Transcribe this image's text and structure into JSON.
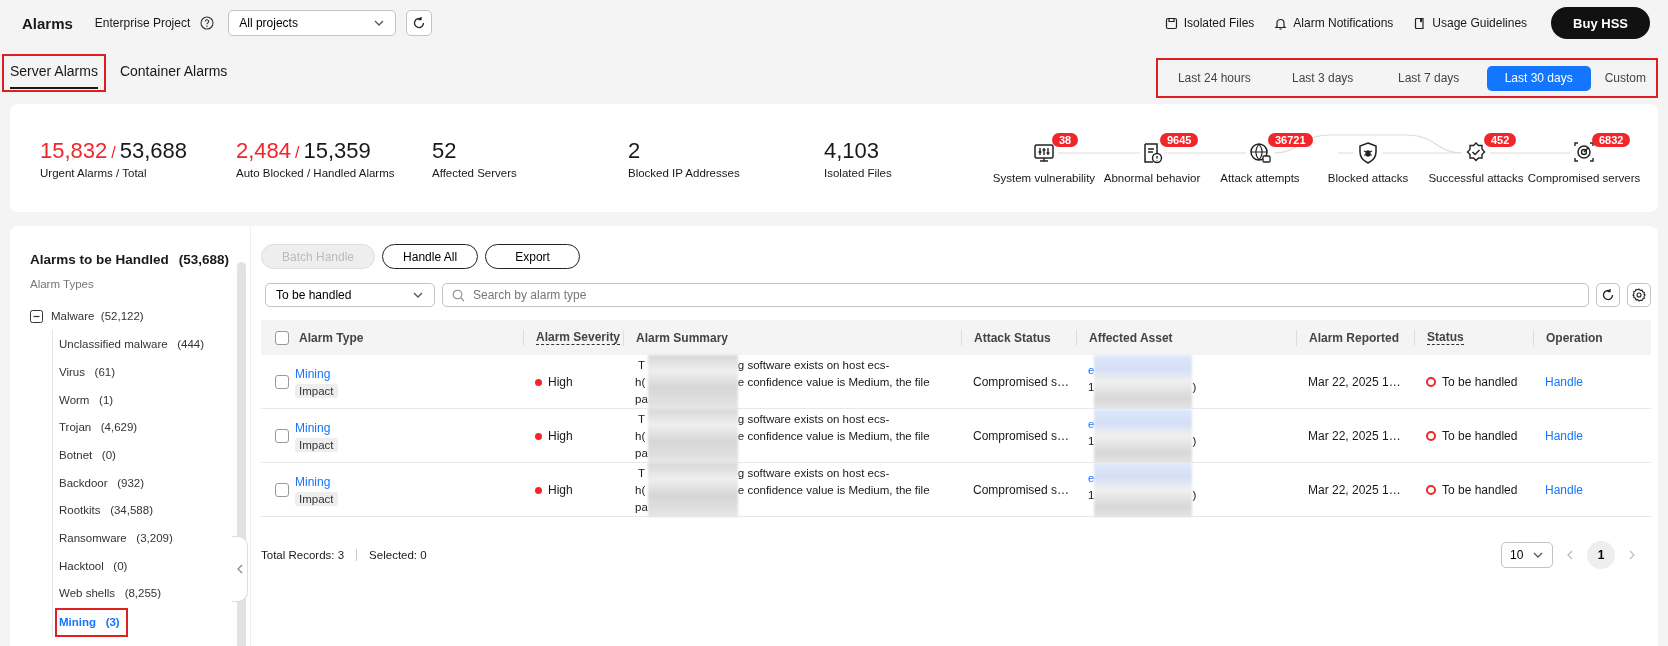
{
  "header": {
    "title": "Alarms",
    "project_label": "Enterprise Project",
    "project_select": "All projects",
    "links": [
      "Isolated Files",
      "Alarm Notifications",
      "Usage Guidelines"
    ],
    "buy_button": "Buy HSS"
  },
  "tabs": [
    {
      "label": "Server Alarms",
      "selected": true,
      "highlighted": true
    },
    {
      "label": "Container Alarms",
      "selected": false,
      "highlighted": false
    }
  ],
  "time_range": {
    "highlighted": true,
    "options": [
      {
        "label": "Last 24 hours",
        "selected": false
      },
      {
        "label": "Last 3 days",
        "selected": false
      },
      {
        "label": "Last 7 days",
        "selected": false
      },
      {
        "label": "Last 30 days",
        "selected": true
      },
      {
        "label": "Custom",
        "selected": false
      }
    ]
  },
  "stats": [
    {
      "kind": "ratio",
      "value": "15,832",
      "separator": "/",
      "total": "53,688",
      "label": "Urgent Alarms  / Total"
    },
    {
      "kind": "ratio",
      "value": "2,484",
      "separator": "/",
      "total": "15,359",
      "label": "Auto Blocked  / Handled Alarms"
    },
    {
      "kind": "single",
      "value": "52",
      "label": "Affected Servers"
    },
    {
      "kind": "single",
      "value": "2",
      "label": "Blocked IP Addresses"
    },
    {
      "kind": "single",
      "value": "4,103",
      "label": "Isolated Files"
    }
  ],
  "attack_chain": [
    {
      "label": "System vulnerability",
      "badge": "38"
    },
    {
      "label": "Abnormal behavior",
      "badge": "9645"
    },
    {
      "label": "Attack attempts",
      "badge": "36721"
    },
    {
      "label": "Blocked attacks"
    },
    {
      "label": "Successful attacks",
      "badge": "452"
    },
    {
      "label": "Compromised servers",
      "badge": "6832"
    }
  ],
  "sidebar": {
    "title": "Alarms to be Handled",
    "count": "(53,688)",
    "subtitle": "Alarm Types",
    "tree": [
      {
        "label": "Malware",
        "count": "(52,122)",
        "expanded": true,
        "selected": false,
        "children": [
          {
            "label": "Unclassified malware",
            "count": "(444)",
            "selected": false,
            "highlighted": false
          },
          {
            "label": "Virus",
            "count": "(61)",
            "selected": false,
            "highlighted": false
          },
          {
            "label": "Worm",
            "count": "(1)",
            "selected": false,
            "highlighted": false
          },
          {
            "label": "Trojan",
            "count": "(4,629)",
            "selected": false,
            "highlighted": false
          },
          {
            "label": "Botnet",
            "count": "(0)",
            "selected": false,
            "highlighted": false
          },
          {
            "label": "Backdoor",
            "count": "(932)",
            "selected": false,
            "highlighted": false
          },
          {
            "label": "Rootkits",
            "count": "(34,588)",
            "selected": false,
            "highlighted": false
          },
          {
            "label": "Ransomware",
            "count": "(3,209)",
            "selected": false,
            "highlighted": false
          },
          {
            "label": "Hacktool",
            "count": "(0)",
            "selected": false,
            "highlighted": false
          },
          {
            "label": "Web shells",
            "count": "(8,255)",
            "selected": false,
            "highlighted": false
          },
          {
            "label": "Mining",
            "count": "(3)",
            "selected": true,
            "highlighted": true
          }
        ]
      }
    ]
  },
  "toolbar": {
    "buttons": [
      {
        "label": "Batch Handle",
        "disabled": true
      },
      {
        "label": "Handle All",
        "disabled": false
      },
      {
        "label": "Export",
        "disabled": false
      }
    ],
    "status_filter": "To be handled",
    "search": {
      "placeholder": "Search by alarm type"
    }
  },
  "table": {
    "select_all_checked": false,
    "columns": [
      {
        "label": "Alarm Type",
        "dashed": false
      },
      {
        "label": "Alarm Severity",
        "dashed": true
      },
      {
        "label": "Alarm Summary",
        "dashed": false
      },
      {
        "label": "Attack Status",
        "dashed": false
      },
      {
        "label": "Affected Asset",
        "dashed": false
      },
      {
        "label": "Alarm Reported",
        "dashed": false
      },
      {
        "label": "Status",
        "dashed": true
      },
      {
        "label": "Operation",
        "dashed": false
      }
    ],
    "rows": [
      {
        "checked": false,
        "type": "Mining",
        "tag": "Impact",
        "severity": "High",
        "summary": [
          {
            "before": " T",
            "after": "g software exists on host ecs-"
          },
          {
            "before": "h(",
            "after": "e confidence value is Medium, the file"
          },
          {
            "before": "pa"
          }
        ],
        "attack_status": "Compromised s…",
        "asset": [
          {
            "before": "e"
          },
          {
            "before": "1",
            "after": ")"
          }
        ],
        "reported": "Mar 22, 2025 1…",
        "status": "To be handled",
        "operation": "Handle"
      },
      {
        "checked": false,
        "type": "Mining",
        "tag": "Impact",
        "severity": "High",
        "summary": [
          {
            "before": " T",
            "after": "g software exists on host ecs-"
          },
          {
            "before": "h(",
            "after": "e confidence value is Medium, the file"
          },
          {
            "before": "pa"
          }
        ],
        "attack_status": "Compromised s…",
        "asset": [
          {
            "before": "e"
          },
          {
            "before": "1",
            "after": ")"
          }
        ],
        "reported": "Mar 22, 2025 1…",
        "status": "To be handled",
        "operation": "Handle"
      },
      {
        "checked": false,
        "type": "Mining",
        "tag": "Impact",
        "severity": "High",
        "summary": [
          {
            "before": " T",
            "after": "g software exists on host ecs-"
          },
          {
            "before": "h(",
            "after": "e confidence value is Medium, the file"
          },
          {
            "before": "pa"
          }
        ],
        "attack_status": "Compromised s…",
        "asset": [
          {
            "before": "e"
          },
          {
            "before": "1",
            "after": ")"
          }
        ],
        "reported": "Mar 22, 2025 1…",
        "status": "To be handled",
        "operation": "Handle"
      }
    ]
  },
  "footer": {
    "total": "Total Records: 3",
    "selected": "Selected: 0",
    "page_size": "10",
    "pages": [
      {
        "label": "1",
        "selected": true
      }
    ]
  }
}
